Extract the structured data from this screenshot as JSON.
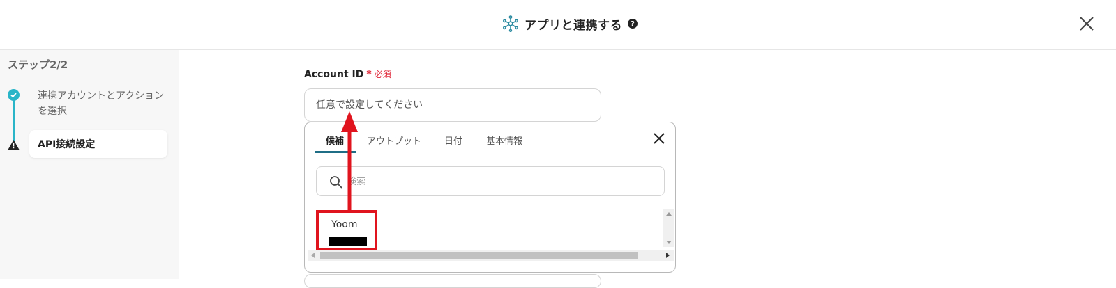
{
  "header": {
    "title": "アプリと連携する",
    "help_symbol": "?",
    "icon": "hub-network-icon",
    "close_icon": "close-icon"
  },
  "sidebar": {
    "step_indicator": "ステップ2/2",
    "steps": [
      {
        "label": "連携アカウントとアクションを選択",
        "status": "complete",
        "icon": "check-circle-icon"
      },
      {
        "label": "API接続設定",
        "status": "warning",
        "icon": "warning-triangle-icon",
        "active": true
      }
    ]
  },
  "form": {
    "account_id": {
      "label": "Account ID",
      "required_mark": "*",
      "required_text": "必須",
      "placeholder": "任意で設定してください"
    }
  },
  "picker": {
    "tabs": [
      {
        "label": "候補",
        "active": true
      },
      {
        "label": "アウトプット",
        "active": false
      },
      {
        "label": "日付",
        "active": false
      },
      {
        "label": "基本情報",
        "active": false
      }
    ],
    "search_placeholder": "検索",
    "results": [
      {
        "name": "Yoom",
        "value_redacted": true
      }
    ]
  },
  "colors": {
    "accent_teal": "#2ab5c8",
    "tab_underline": "#1f6e86",
    "required_red": "#e0283a",
    "annotation_red": "#e0141e"
  }
}
